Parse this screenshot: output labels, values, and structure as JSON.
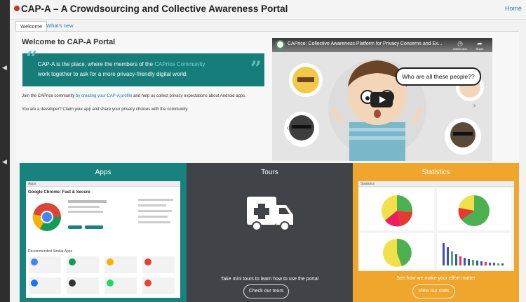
{
  "header": {
    "title": "CAP-A – A Crowdsourcing and Collective Awareness Portal",
    "home_link": "Home"
  },
  "tabs": [
    {
      "label": "Welcome",
      "active": true
    },
    {
      "label": "What's new",
      "active": false
    }
  ],
  "welcome": {
    "heading": "Welcome to CAP-A Portal",
    "quote_part1": "CAP-A is the place, where the members of the ",
    "quote_link": "CAPrice Community",
    "quote_part2": "work together to ask for a more privacy-friendly digital world.",
    "line1_part1": "Join the CAPrice community ",
    "line1_link": "by creating your CAP-A profile",
    "line1_part2": " and help us collect privacy expectations about Android apps.",
    "line2": "You are a developer? Claim your app and share your privacy choices with the community."
  },
  "video": {
    "title": "CAPrice: Collective Awareness Platform for Privacy Concerns and Ex...",
    "watch_later": "Watch later",
    "share": "Share",
    "speech_bubble": "Who are all these people??"
  },
  "sections": {
    "apps": {
      "title": "Apps",
      "thumb_header": "Apps",
      "thumb_app_title": "Google Chrome: Fast & Secure",
      "thumb_similar": "Recommended Similar Apps"
    },
    "tours": {
      "title": "Tours",
      "description": "Take mini tours to learn how to use the portal",
      "button": "Check our tours"
    },
    "statistics": {
      "title": "Statistics",
      "thumb_header": "Statistics",
      "description": "See how we make your effort matter",
      "button": "View our stats"
    }
  },
  "colors": {
    "teal": "#18837e",
    "dark": "#404448",
    "orange": "#f0a52c",
    "link": "#1b7fa8"
  }
}
